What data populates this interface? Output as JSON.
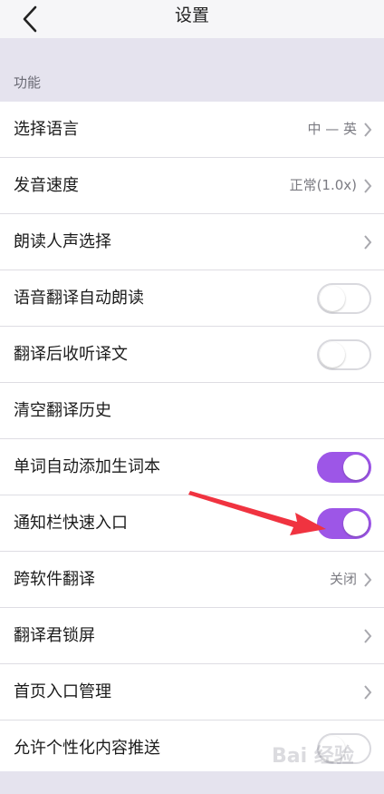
{
  "header": {
    "title": "设置"
  },
  "section": {
    "title": "功能"
  },
  "rows": [
    {
      "label": "选择语言",
      "value": "中 — 英",
      "control": "chevron"
    },
    {
      "label": "发音速度",
      "value": "正常(1.0x)",
      "control": "chevron"
    },
    {
      "label": "朗读人声选择",
      "value": "",
      "control": "chevron"
    },
    {
      "label": "语音翻译自动朗读",
      "value": "",
      "control": "toggle",
      "on": false
    },
    {
      "label": "翻译后收听译文",
      "value": "",
      "control": "toggle",
      "on": false
    },
    {
      "label": "清空翻译历史",
      "value": "",
      "control": "none"
    },
    {
      "label": "单词自动添加生词本",
      "value": "",
      "control": "toggle",
      "on": true
    },
    {
      "label": "通知栏快速入口",
      "value": "",
      "control": "toggle",
      "on": true
    },
    {
      "label": "跨软件翻译",
      "value": "关闭",
      "control": "chevron"
    },
    {
      "label": "翻译君锁屏",
      "value": "",
      "control": "chevron"
    },
    {
      "label": "首页入口管理",
      "value": "",
      "control": "chevron"
    },
    {
      "label": "允许个性化内容推送",
      "value": "",
      "control": "toggle",
      "on": false
    }
  ],
  "watermark": {
    "text": "Bai 经验"
  },
  "colors": {
    "accent": "#9d56e7",
    "annotation_arrow": "#f03340",
    "section_background": "#e5e3ee"
  },
  "icons": {
    "back": "back-arrow-icon",
    "chevron": "chevron-right-icon"
  }
}
